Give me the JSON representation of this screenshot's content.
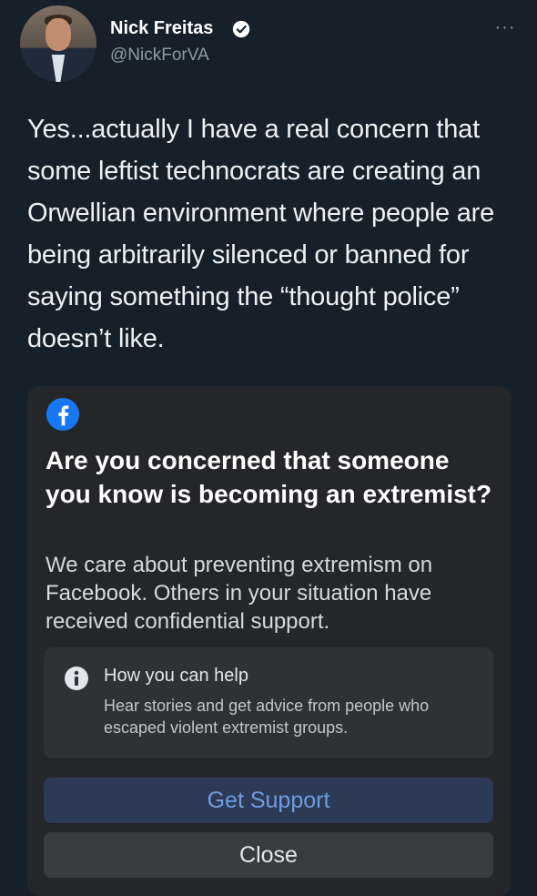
{
  "tweet": {
    "author_name": "Nick Freitas",
    "handle": "@NickForVA",
    "text": "Yes...actually I have a real concern that some leftist technocrats are creating an Orwellian environment where people are being arbitrarily silenced or banned for saying something the “thought police” doesn’t like.",
    "more_label": "···"
  },
  "facebook_card": {
    "title": "Are you concerned that someone you know is becoming an extremist?",
    "body": "We care about preventing extremism on Facebook. Others in your situation have received confidential support.",
    "help_box": {
      "title": "How you can help",
      "description": "Hear stories and get advice from people who escaped violent extremist groups."
    },
    "primary_button": "Get Support",
    "secondary_button": "Close"
  },
  "colors": {
    "background": "#15202b",
    "verified_blue": "#1d9bf0",
    "facebook_blue": "#1877f2",
    "card": "#252629"
  },
  "icons": {
    "verified": "verified-badge-icon",
    "facebook": "facebook-logo-icon",
    "info": "info-icon",
    "more": "more-options-icon"
  }
}
